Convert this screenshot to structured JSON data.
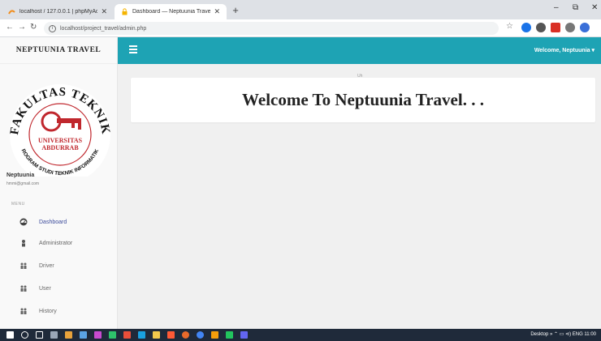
{
  "browser": {
    "tabs": [
      {
        "title": "localhost / 127.0.0.1 | phpMyAdm"
      },
      {
        "title": "Dashboard — Neptuunia Travel"
      }
    ],
    "url": "localhost/project_travel/admin.php",
    "minimize": "–",
    "maximize": "⧉",
    "close": "✕"
  },
  "sidebar": {
    "brand": "NEPTUUNIA TRAVEL",
    "logo": {
      "top_text": "FAKULTAS TEKNIK",
      "mid_text_1": "UNIVERSITAS",
      "mid_text_2": "ABDURRAB",
      "bottom_text": "PROGRAM STUDI TEKNIK INFORMATIKA"
    },
    "profile_name": "Neptuunia",
    "profile_email": "hmmi@gmail.com",
    "menu_heading": "MENU",
    "items": [
      {
        "label": "Dashboard",
        "icon": "dashboard-icon"
      },
      {
        "label": "Administrator",
        "icon": "user-icon"
      },
      {
        "label": "Driver",
        "icon": "users-icon"
      },
      {
        "label": "User",
        "icon": "users-icon"
      },
      {
        "label": "History",
        "icon": "users-icon"
      }
    ]
  },
  "topbar": {
    "welcome": "Welcome, Neptuunia ▾"
  },
  "content": {
    "tiny_label": "Uh",
    "heading": "Welcome To Neptuunia Travel. . ."
  },
  "taskbar": {
    "tray": "Desktop »  ⌃  ▭  ⊲)  ENG  11:00"
  },
  "colors": {
    "topbar": "#1ea3b4",
    "active_menu": "#3c4b9b",
    "logo_red": "#c0272d"
  }
}
